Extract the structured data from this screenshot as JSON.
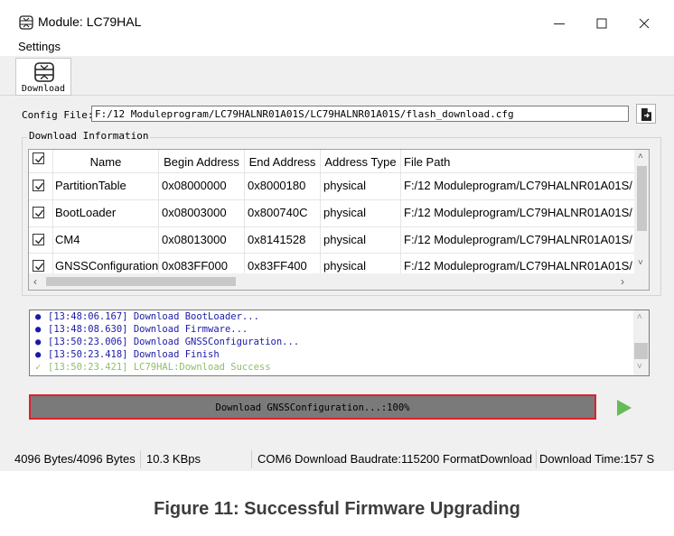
{
  "window": {
    "title": "Module: LC79HAL",
    "app_icon": "download-tool-icon",
    "controls": {
      "minimize": "minimize-icon",
      "maximize": "maximize-icon",
      "close": "close-icon"
    }
  },
  "menu": {
    "items": [
      "Settings"
    ]
  },
  "toolbar": {
    "download_label": "Download",
    "download_icon": "download-tool-icon"
  },
  "config": {
    "label": "Config File:",
    "value": "F:/12 Moduleprogram/LC79HALNR01A01S/LC79HALNR01A01S/flash_download.cfg",
    "browse_icon": "open-file-icon"
  },
  "download_info": {
    "title": "Download Information",
    "columns": [
      "",
      "Name",
      "Begin Address",
      "End Address",
      "Address Type",
      "File Path"
    ],
    "rows": [
      {
        "checked": true,
        "name": "PartitionTable",
        "begin": "0x08000000",
        "end": "0x8000180",
        "type": "physical",
        "path": "F:/12 Moduleprogram/LC79HALNR01A01S/"
      },
      {
        "checked": true,
        "name": "BootLoader",
        "begin": "0x08003000",
        "end": "0x800740C",
        "type": "physical",
        "path": "F:/12 Moduleprogram/LC79HALNR01A01S/"
      },
      {
        "checked": true,
        "name": "CM4",
        "begin": "0x08013000",
        "end": "0x8141528",
        "type": "physical",
        "path": "F:/12 Moduleprogram/LC79HALNR01A01S/"
      },
      {
        "checked": true,
        "name": "GNSSConfiguration",
        "begin": "0x083FF000",
        "end": "0x83FF400",
        "type": "physical",
        "path": "F:/12 Moduleprogram/LC79HALNR01A01S/"
      }
    ]
  },
  "log": {
    "lines": [
      {
        "bullet": "●",
        "text": "[13:48:06.167] Download BootLoader...",
        "color": "#1a1aa8"
      },
      {
        "bullet": "●",
        "text": "[13:48:08.630] Download Firmware...",
        "color": "#1a1aa8"
      },
      {
        "bullet": "●",
        "text": "[13:50:23.006] Download GNSSConfiguration...",
        "color": "#1a1aa8"
      },
      {
        "bullet": "●",
        "text": "[13:50:23.418] Download Finish",
        "color": "#1a1aa8"
      },
      {
        "bullet": "✓",
        "text": "[13:50:23.421] LC79HAL:Download Success",
        "color": "#8cbf6a"
      }
    ]
  },
  "progress": {
    "text": "Download GNSSConfiguration...:100%",
    "percent": 100,
    "border_color": "#e0202a",
    "fill_color": "#7a7a7a"
  },
  "start_button": {
    "icon": "play-icon",
    "color": "#66bb55"
  },
  "status": {
    "bytes": "4096 Bytes/4096 Bytes",
    "speed": "10.3 KBps",
    "port": "COM6 Download Baudrate:115200 FormatDownload",
    "time": "Download Time:157 S"
  },
  "caption": "Figure 11: Successful Firmware Upgrading"
}
